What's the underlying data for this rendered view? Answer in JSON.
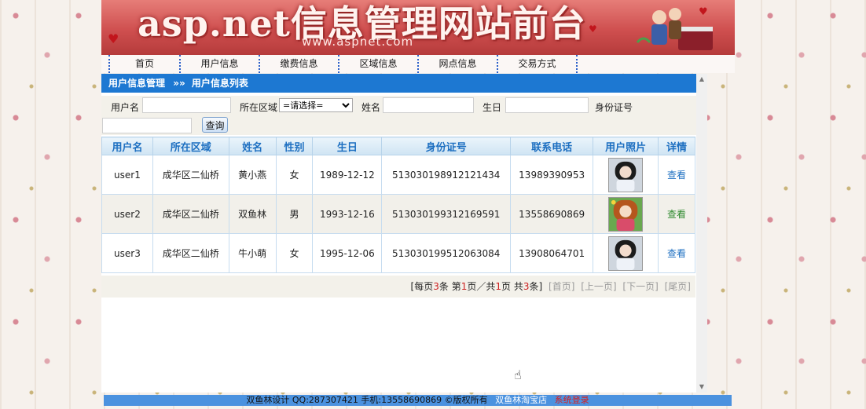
{
  "banner": {
    "title": "asp.net信息管理网站前台",
    "url": "www.aspnet.com"
  },
  "nav": {
    "items": [
      {
        "label": "首页"
      },
      {
        "label": "用户信息"
      },
      {
        "label": "缴费信息"
      },
      {
        "label": "区域信息"
      },
      {
        "label": "网点信息"
      },
      {
        "label": "交易方式"
      }
    ]
  },
  "title_bar": {
    "section": "用户信息管理",
    "sep": "»»",
    "page": "用户信息列表"
  },
  "search": {
    "username_label": "用户名",
    "area_label": "所在区域",
    "area_selected": "=请选择=",
    "name_label": "姓名",
    "birthday_label": "生日",
    "idcard_label": "身份证号",
    "query_button": "查询"
  },
  "table": {
    "headers": [
      "用户名",
      "所在区域",
      "姓名",
      "性别",
      "生日",
      "身份证号",
      "联系电话",
      "用户照片",
      "详情"
    ],
    "rows": [
      {
        "username": "user1",
        "area": "成华区二仙桥",
        "name": "黄小燕",
        "gender": "女",
        "birthday": "1989-12-12",
        "idcard": "513030198912121434",
        "phone": "13989390953",
        "detail": "查看"
      },
      {
        "username": "user2",
        "area": "成华区二仙桥",
        "name": "双鱼林",
        "gender": "男",
        "birthday": "1993-12-16",
        "idcard": "513030199312169591",
        "phone": "13558690869",
        "detail": "查看"
      },
      {
        "username": "user3",
        "area": "成华区二仙桥",
        "name": "牛小萌",
        "gender": "女",
        "birthday": "1995-12-06",
        "idcard": "513030199512063084",
        "phone": "13908064701",
        "detail": "查看"
      }
    ]
  },
  "pager": {
    "per_page_pre": "[每页",
    "per_page": "3",
    "per_page_post": "条",
    "page_pre": "第",
    "page": "1",
    "page_mid": "页／共",
    "total_pages": "1",
    "page_post": "页",
    "total_pre": "共",
    "total": "3",
    "total_post": "条]",
    "first": "[首页]",
    "prev": "[上一页]",
    "next": "[下一页]",
    "last": "[尾页]"
  },
  "footer": {
    "info": "双鱼林设计 QQ:287307421 手机:13558690869 ©版权所有",
    "shop": "双鱼林淘宝店",
    "login": "系统登录"
  }
}
